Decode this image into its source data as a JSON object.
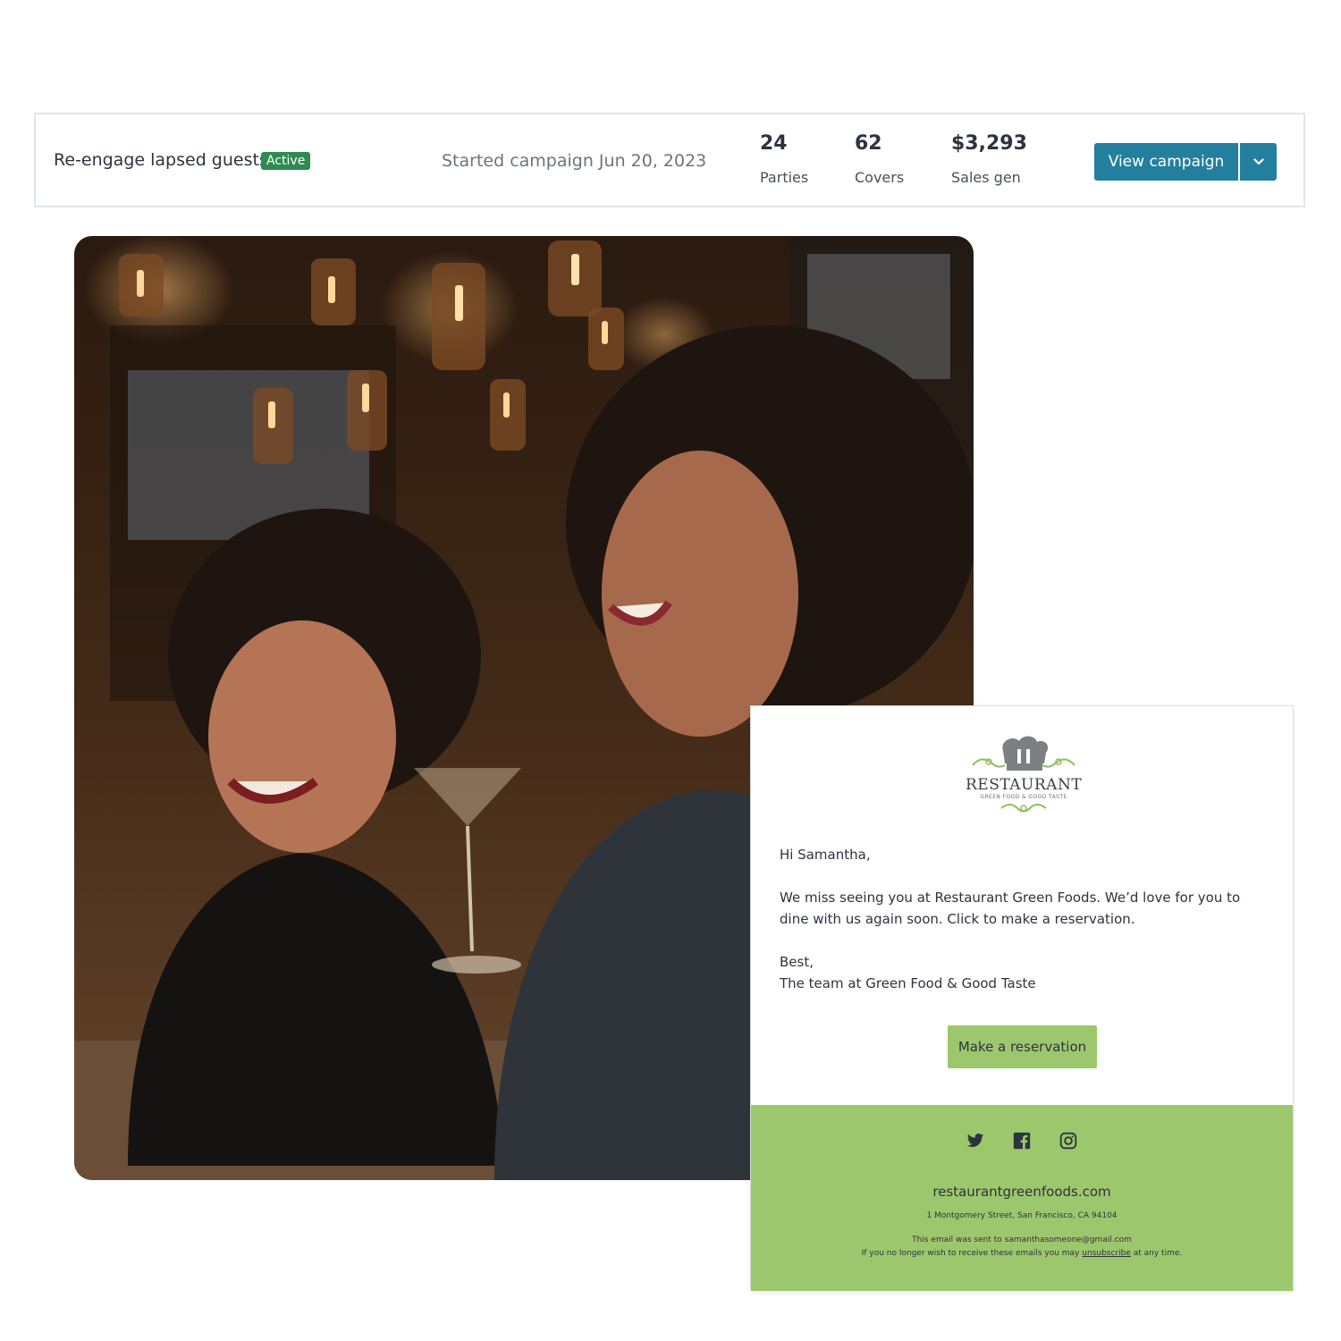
{
  "campaign": {
    "name": "Re-engage lapsed guests",
    "status": "Active",
    "started": "Started campaign Jun 20, 2023",
    "stats": [
      {
        "value": "24",
        "label": "Parties"
      },
      {
        "value": "62",
        "label": "Covers"
      },
      {
        "value": "$3,293",
        "label": "Sales gen"
      }
    ],
    "view_button": "View campaign"
  },
  "email": {
    "logo_word": "RESTAURANT",
    "logo_tagline": "GREEN FOOD & GOOD TASTE",
    "greeting": "Hi Samantha,",
    "body": "We miss seeing you at Restaurant Green Foods. We’d love for you to dine with us again soon. Click to make a reservation.",
    "signoff": "Best,",
    "signature": "The team at Green Food & Good Taste",
    "cta": "Make a reservation",
    "footer": {
      "website": "restaurantgreenfoods.com",
      "address": "1 Montgomery Street, San Francisco, CA 94104",
      "sent_to": "This email was sent to samanthasomeone@gmail.com",
      "unsub_prefix": "If you no longer wish to receive these emails you may",
      "unsub_link": "unsubscribe",
      "unsub_suffix": "at any time."
    }
  },
  "colors": {
    "primary_button": "#247f9e",
    "active_badge": "#2e8b4f",
    "brand_green": "#9dc76d"
  },
  "icons": [
    "twitter-icon",
    "facebook-icon",
    "instagram-icon",
    "chevron-down-icon",
    "chef-hat-icon"
  ]
}
